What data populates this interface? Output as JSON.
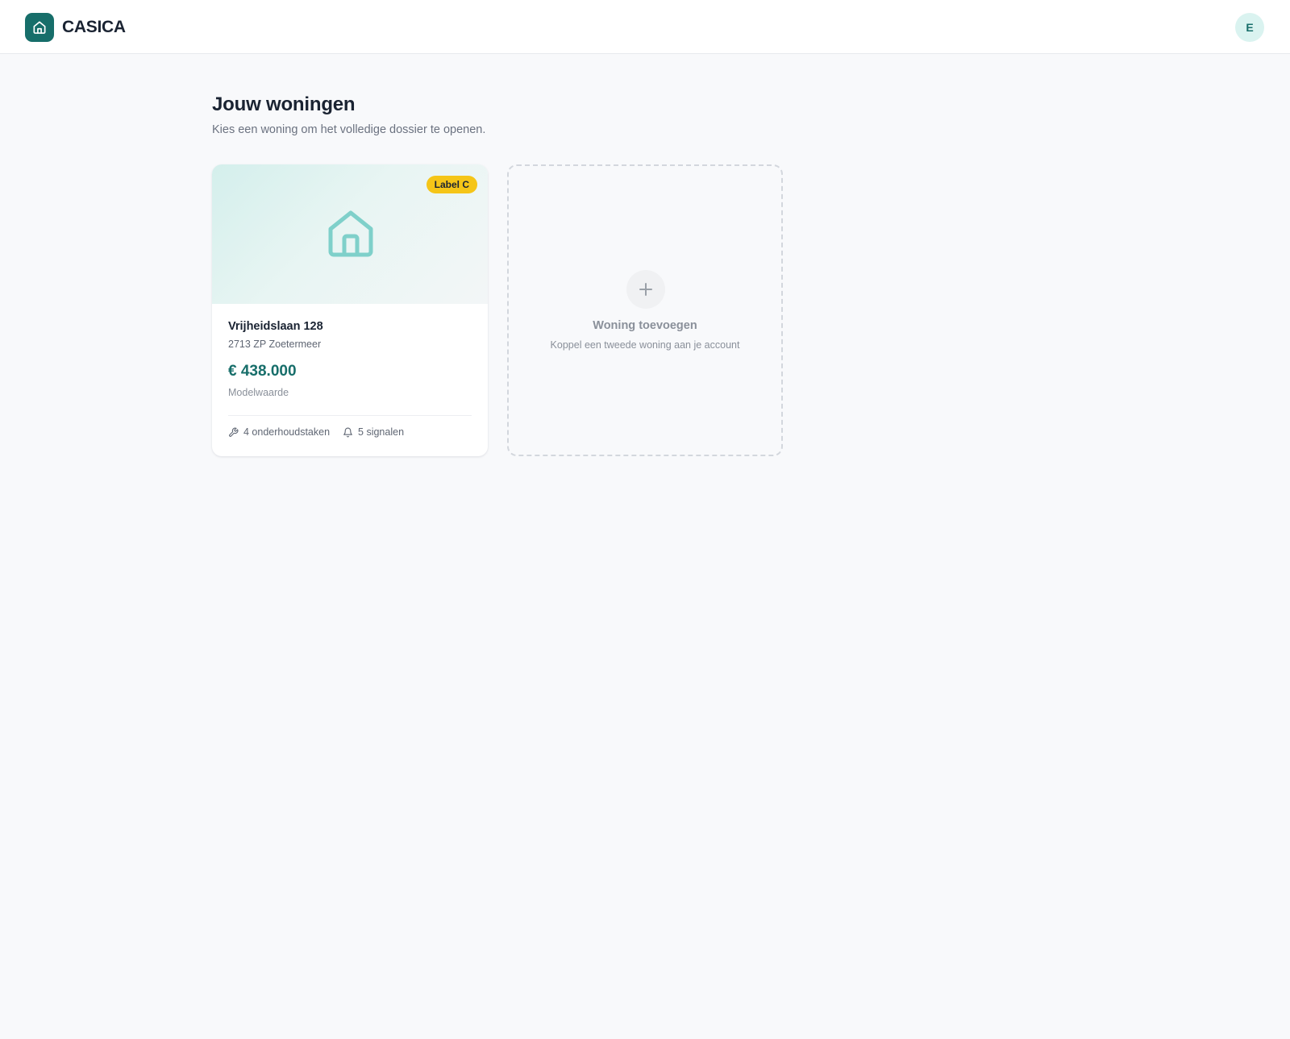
{
  "header": {
    "brand_name": "CASICA",
    "brand_icon": "home-icon",
    "avatar_initial": "E",
    "accent_color": "#176e6a"
  },
  "page": {
    "title": "Jouw woningen",
    "subtitle": "Kies een woning om het volledige dossier te openen."
  },
  "properties": [
    {
      "energy_label": "Label C",
      "energy_label_color": "#f5c518",
      "hero_icon": "home-icon",
      "street": "Vrijheidslaan 128",
      "city": "2713 ZP Zoetermeer",
      "price": "€ 438.000",
      "price_caption": "Modelwaarde",
      "maintenance": {
        "icon": "wrench-icon",
        "label": "4 onderhoudstaken"
      },
      "signals": {
        "icon": "bell-icon",
        "label": "5 signalen"
      }
    }
  ],
  "add_property": {
    "icon": "plus-icon",
    "title": "Woning toevoegen",
    "subtitle": "Koppel een tweede woning aan je account"
  }
}
